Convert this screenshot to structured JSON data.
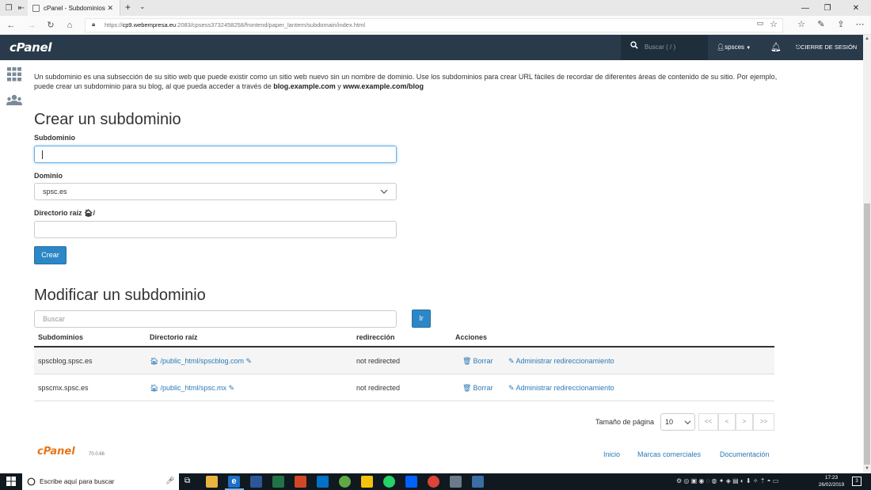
{
  "browser": {
    "tab_title": "cPanel - Subdominios",
    "url_prefix": "https://",
    "url_host": "cp9.webempresa.eu",
    "url_rest": ":2083/cpsess3732458258/frontend/paper_lantern/subdomain/index.html"
  },
  "header": {
    "logo": "cPanel",
    "search_placeholder": "Buscar ( / )",
    "username": "spsces",
    "logout_label": "CIERRE DE SESIÓN"
  },
  "intro": {
    "text_1": "Un subdominio es una subsección de su sitio web que puede existir como un sitio web nuevo sin un nombre de dominio. Use los subdominios para crear URL fáciles de recordar de diferentes áreas de contenido de su sitio. Por ejemplo, puede crear un subdominio para su blog, al que pueda acceder a través de ",
    "example_1": "blog.example.com",
    "conj": " y ",
    "example_2": "www.example.com/blog"
  },
  "create": {
    "title": "Crear un subdominio",
    "subdomain_label": "Subdominio",
    "subdomain_value": "",
    "domain_label": "Dominio",
    "domain_value": "spsc.es",
    "docroot_label": "Directorio raíz",
    "docroot_suffix": "/",
    "docroot_value": "",
    "create_button": "Crear"
  },
  "modify": {
    "title": "Modificar un subdominio",
    "search_placeholder": "Buscar",
    "go_button": "Ir",
    "columns": [
      "Subdominios",
      "Directorio raíz",
      "redirección",
      "Acciones"
    ],
    "rows": [
      {
        "subdomain": "spscblog.spsc.es",
        "docroot": "/public_html/spscblog.com",
        "redirection": "not redirected",
        "delete": "Borrar",
        "manage": "Administrar redireccionamiento"
      },
      {
        "subdomain": "spscmx.spsc.es",
        "docroot": "/public_html/spsc.mx",
        "redirection": "not redirected",
        "delete": "Borrar",
        "manage": "Administrar redireccionamiento"
      }
    ]
  },
  "pagination": {
    "page_size_label": "Tamaño de página",
    "page_size": "10",
    "first": "<<",
    "prev": "<",
    "next": ">",
    "last": ">>"
  },
  "footer": {
    "logo": "cPanel",
    "version": "70.0.66",
    "links": [
      "Inicio",
      "Marcas comerciales",
      "Documentación"
    ]
  },
  "taskbar": {
    "search_placeholder": "Escribe aquí para buscar",
    "time": "17:23",
    "date": "26/02/2019",
    "notif_count": "3"
  },
  "colors": {
    "header_bg": "#293a4a",
    "accent_blue": "#2c87c7",
    "link_blue": "#2a7ab7",
    "logo_orange": "#e8751a"
  }
}
